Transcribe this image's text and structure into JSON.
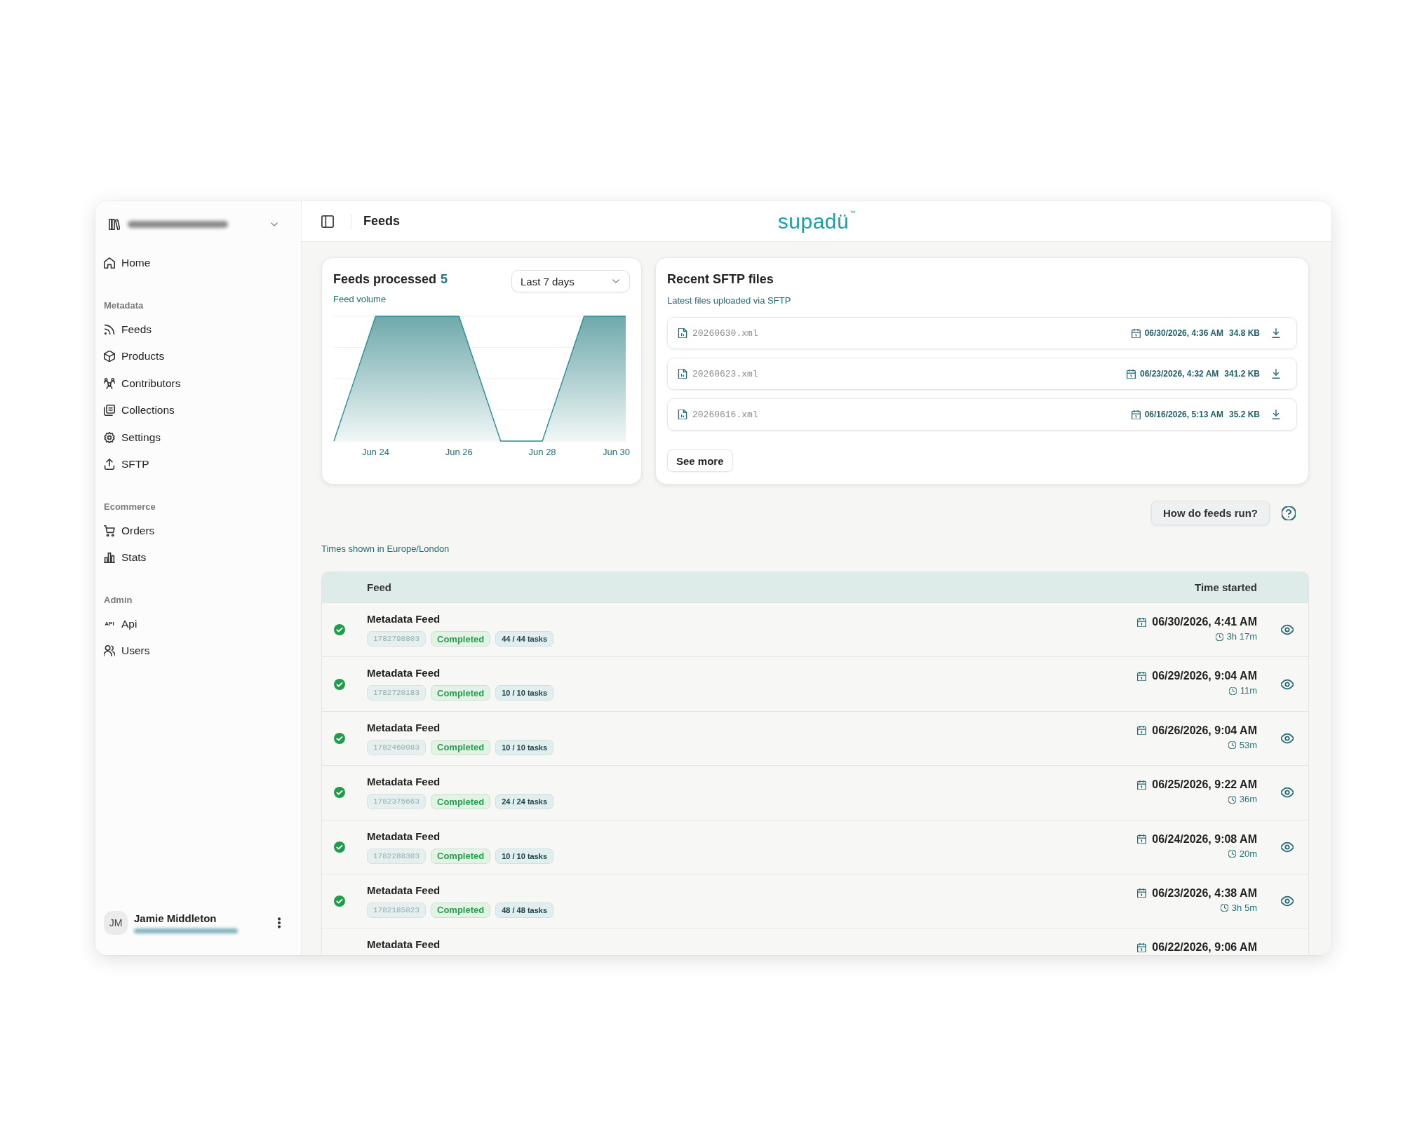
{
  "sidebar": {
    "home": {
      "label": "Home"
    },
    "sections": [
      {
        "heading": "Metadata",
        "items": [
          {
            "label": "Feeds"
          },
          {
            "label": "Products"
          },
          {
            "label": "Contributors"
          },
          {
            "label": "Collections"
          },
          {
            "label": "Settings"
          },
          {
            "label": "SFTP"
          }
        ]
      },
      {
        "heading": "Ecommerce",
        "items": [
          {
            "label": "Orders"
          },
          {
            "label": "Stats"
          }
        ]
      },
      {
        "heading": "Admin",
        "items": [
          {
            "icon_text": "API",
            "label": "Api"
          },
          {
            "label": "Users"
          }
        ]
      }
    ],
    "user": {
      "initials": "JM",
      "name": "Jamie Middleton"
    }
  },
  "header": {
    "title": "Feeds",
    "logo": "supadü",
    "logo_mark": "™"
  },
  "feeds_card": {
    "title": "Feeds processed",
    "count": "5",
    "subtitle": "Feed volume",
    "range": "Last 7 days",
    "axis_labels": [
      "Jun 24",
      "Jun 26",
      "Jun 28",
      "Jun 30"
    ]
  },
  "sftp_card": {
    "title": "Recent SFTP files",
    "subtitle": "Latest files uploaded via SFTP",
    "files": [
      {
        "name": "20260630.xml",
        "uploaded": "06/30/2026, 4:36 AM",
        "size": "34.8 KB"
      },
      {
        "name": "20260623.xml",
        "uploaded": "06/23/2026, 4:32 AM",
        "size": "341.2 KB"
      },
      {
        "name": "20260616.xml",
        "uploaded": "06/16/2026, 5:13 AM",
        "size": "35.2 KB"
      }
    ],
    "see_more": "See more"
  },
  "help_button": "How do feeds run?",
  "timezone_note": "Times shown in Europe/London",
  "table": {
    "columns": [
      "Feed",
      "Time started"
    ],
    "rows": [
      {
        "name": "Metadata Feed",
        "id": "1782798803",
        "status": "Completed",
        "tasks": "44 / 44 tasks",
        "started": "06/30/2026, 4:41 AM",
        "duration": "3h 17m"
      },
      {
        "name": "Metadata Feed",
        "id": "1782720183",
        "status": "Completed",
        "tasks": "10 / 10 tasks",
        "started": "06/29/2026, 9:04 AM",
        "duration": "11m"
      },
      {
        "name": "Metadata Feed",
        "id": "1782460983",
        "status": "Completed",
        "tasks": "10 / 10 tasks",
        "started": "06/26/2026, 9:04 AM",
        "duration": "53m"
      },
      {
        "name": "Metadata Feed",
        "id": "1782375663",
        "status": "Completed",
        "tasks": "24 / 24 tasks",
        "started": "06/25/2026, 9:22 AM",
        "duration": "36m"
      },
      {
        "name": "Metadata Feed",
        "id": "1782288303",
        "status": "Completed",
        "tasks": "10 / 10 tasks",
        "started": "06/24/2026, 9:08 AM",
        "duration": "20m"
      },
      {
        "name": "Metadata Feed",
        "id": "1782185823",
        "status": "Completed",
        "tasks": "48 / 48 tasks",
        "started": "06/23/2026, 4:38 AM",
        "duration": "3h 5m"
      },
      {
        "name": "Metadata Feed",
        "started": "06/22/2026, 9:06 AM"
      }
    ]
  }
}
